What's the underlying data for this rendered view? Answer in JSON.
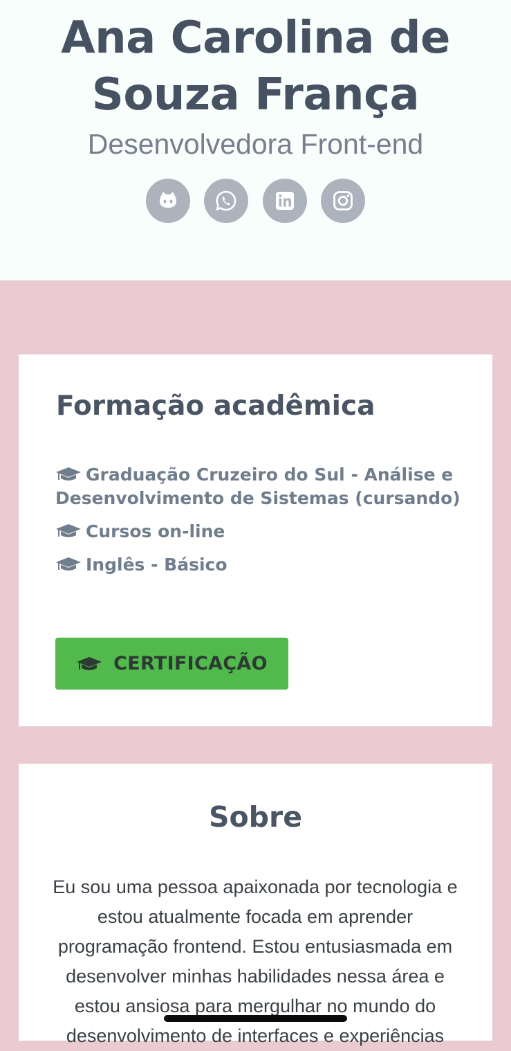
{
  "header": {
    "name": "Ana Carolina de Souza França",
    "role": "Desenvolvedora Front-end",
    "socials": [
      {
        "icon": "github-icon",
        "label": "GitHub"
      },
      {
        "icon": "whatsapp-icon",
        "label": "WhatsApp"
      },
      {
        "icon": "linkedin-icon",
        "label": "LinkedIn"
      },
      {
        "icon": "instagram-icon",
        "label": "Instagram"
      }
    ]
  },
  "education": {
    "title": "Formação acadêmica",
    "items": [
      "Graduação Cruzeiro do Sul - Análise e Desenvolvimento de Sistemas (cursando)",
      "Cursos on-line",
      "Inglês - Básico"
    ],
    "button_label": "CERTIFICAÇÃO",
    "icon": "graduation-cap-icon"
  },
  "about": {
    "title": "Sobre",
    "text": "Eu sou uma pessoa apaixonada por tecnologia e estou atualmente focada em aprender programação frontend. Estou entusiasmada em desenvolver minhas habilidades nessa área e estou ansiosa para mergulhar no mundo do desenvolvimento de interfaces e experiências"
  },
  "colors": {
    "page_bg": "#e9cbd1",
    "header_bg": "#f7fefc",
    "title": "#465261",
    "button": "#52b94c",
    "social_bg": "#adb3bd"
  }
}
